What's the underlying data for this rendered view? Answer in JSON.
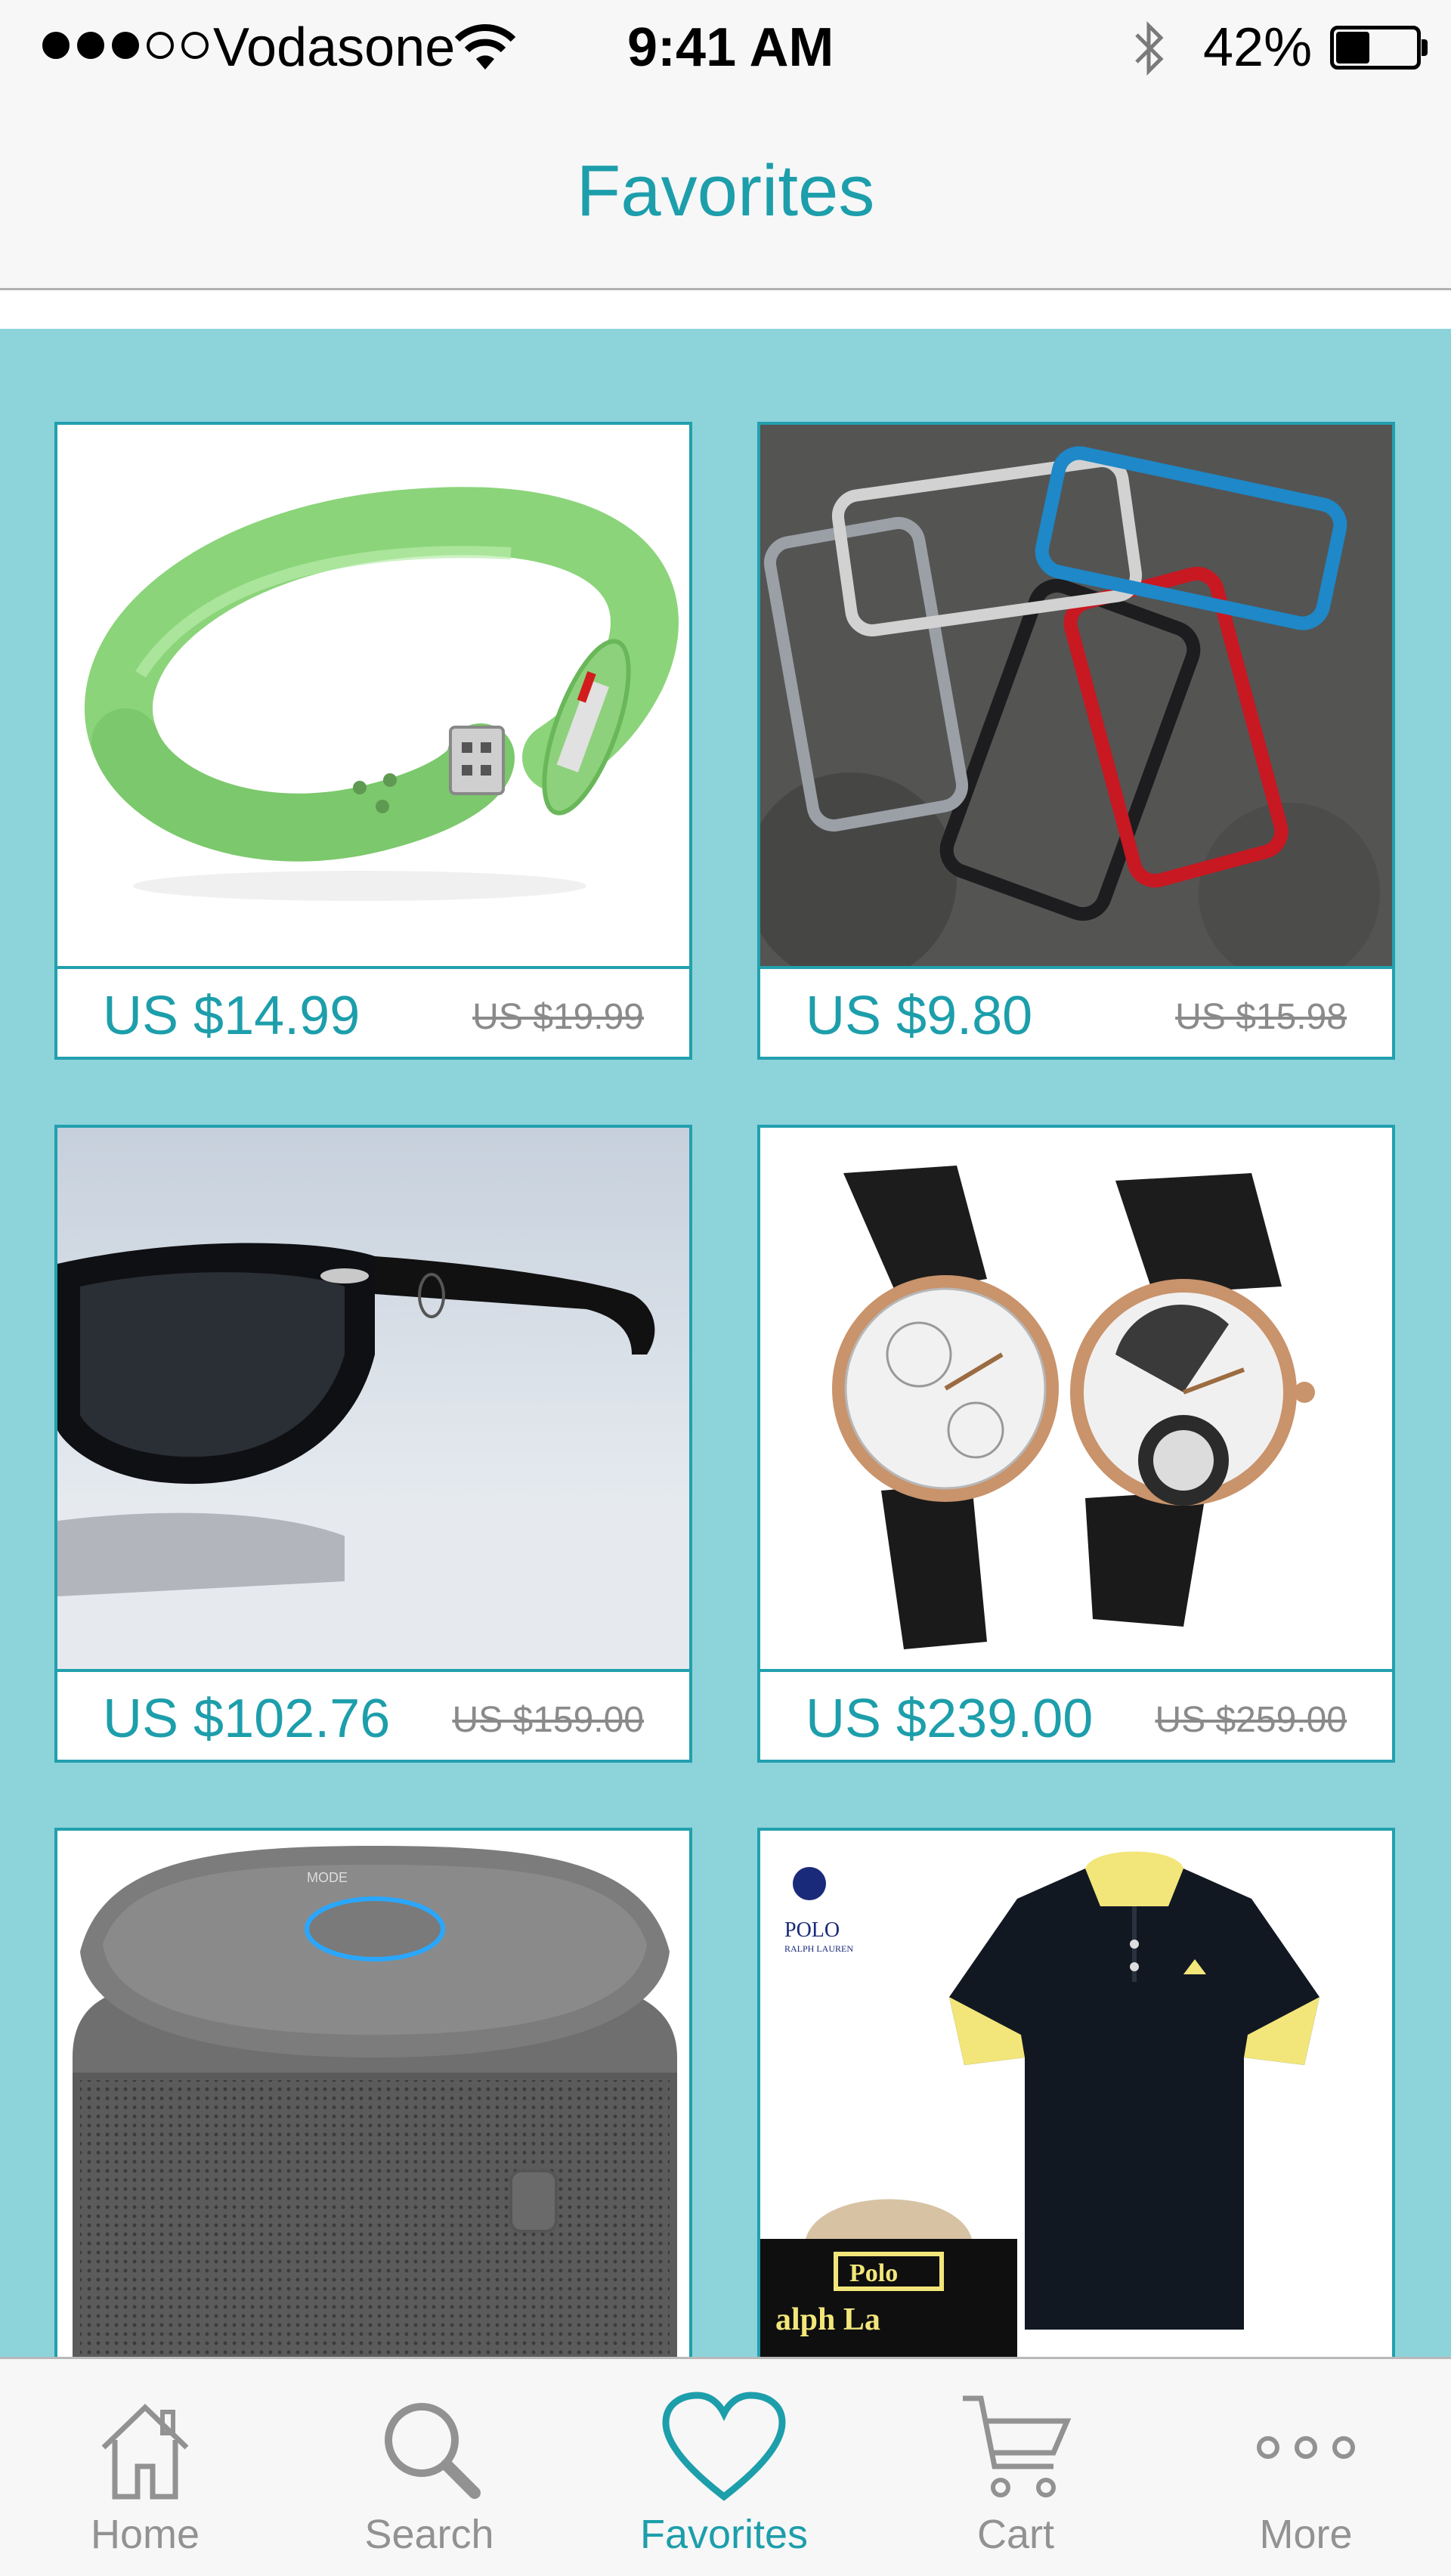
{
  "status_bar": {
    "carrier": "Vodasone",
    "time": "9:41 AM",
    "battery": "42%",
    "battery_level": 0.42
  },
  "nav": {
    "title": "Favorites"
  },
  "products": [
    {
      "price": "US $14.99",
      "old_price": "US $19.99",
      "image": "usb-wristband"
    },
    {
      "price": "US $9.80",
      "old_price": "US $15.98",
      "image": "phone-bumpers"
    },
    {
      "price": "US $102.76",
      "old_price": "US $159.00",
      "image": "sunglasses"
    },
    {
      "price": "US $239.00",
      "old_price": "US $259.00",
      "image": "wristwatches"
    },
    {
      "image": "bluetooth-speaker",
      "speaker_label": "MODE"
    },
    {
      "image": "polo-shirt",
      "brand_top": "POLO",
      "brand_sub": "RALPH LAUREN",
      "brand_bottom": "Polo",
      "brand_bottom_sub": "alph La"
    }
  ],
  "tabs": [
    {
      "label": "Home",
      "icon": "home-icon"
    },
    {
      "label": "Search",
      "icon": "search-icon"
    },
    {
      "label": "Favorites",
      "icon": "heart-icon",
      "active": true
    },
    {
      "label": "Cart",
      "icon": "cart-icon"
    },
    {
      "label": "More",
      "icon": "more-icon"
    }
  ],
  "colors": {
    "accent": "#1d9eab",
    "content_bg": "#8dd3da",
    "card_border": "#22a0ae",
    "inactive_tab": "#929292"
  }
}
